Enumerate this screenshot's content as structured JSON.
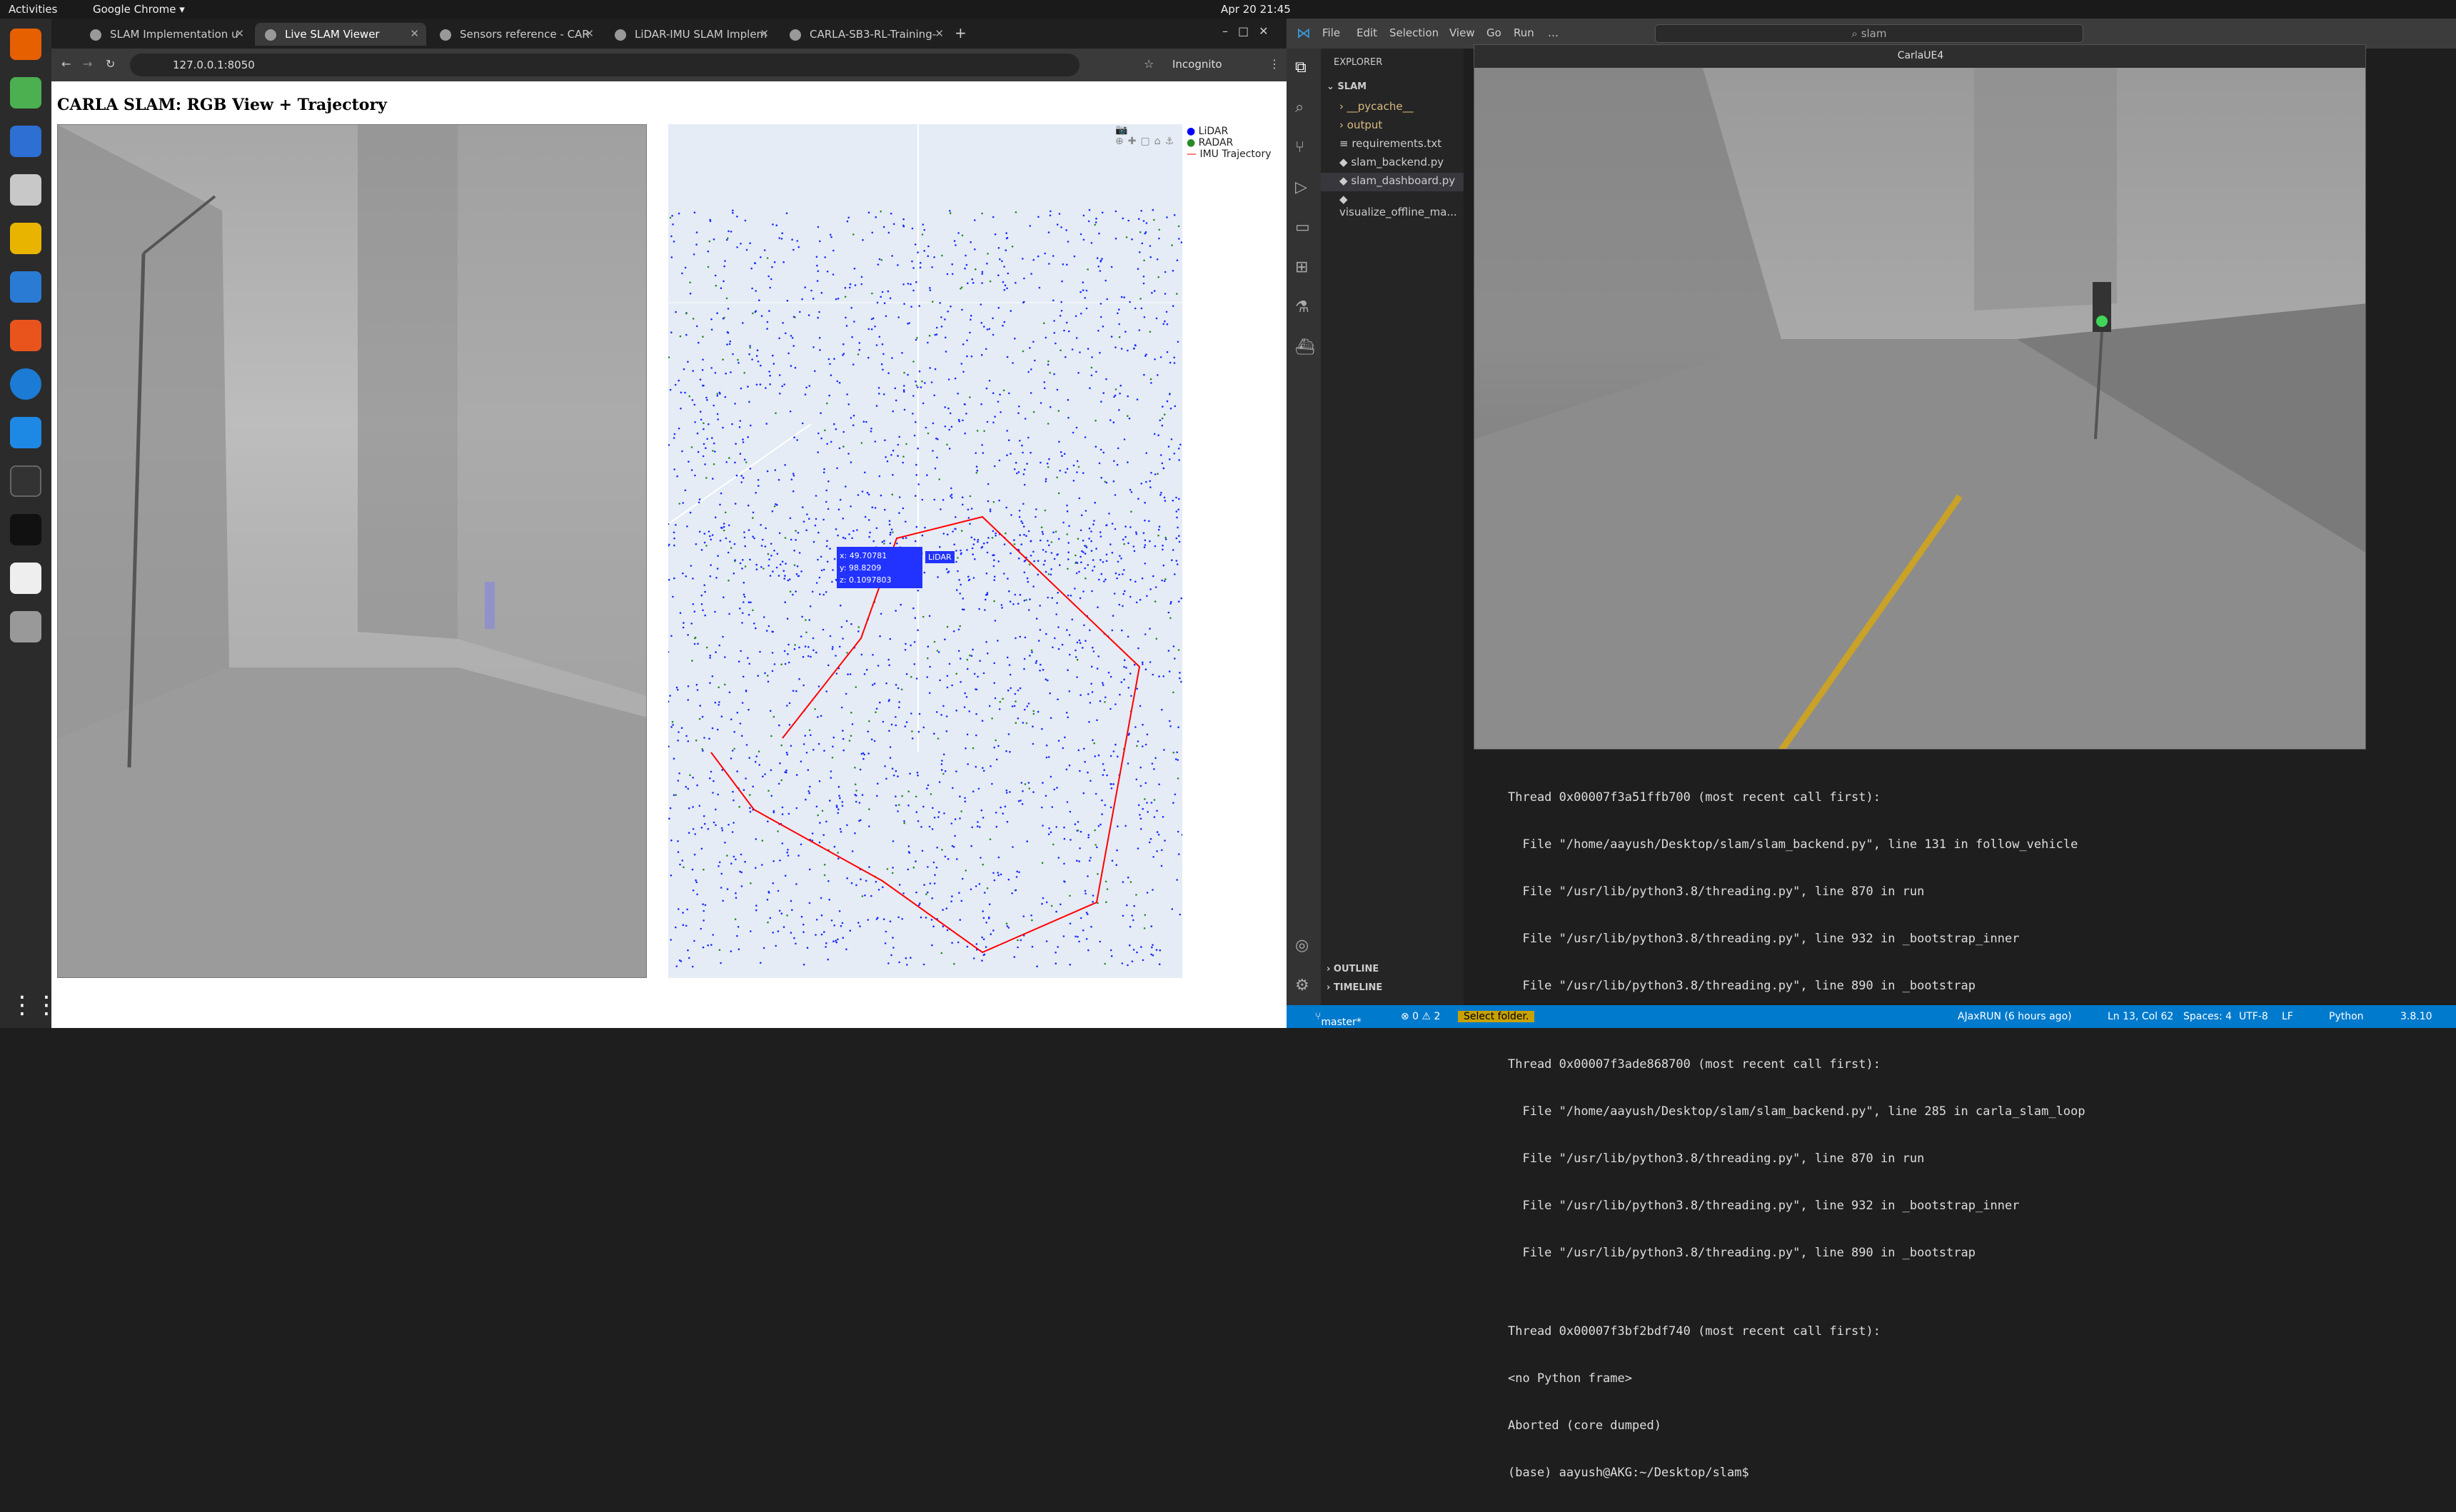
{
  "topbar": {
    "activities": "Activities",
    "app": "Google Chrome ▾",
    "clock": "Apr 20  21:45"
  },
  "dock": {
    "icons": [
      "firefox-icon",
      "chrome-icon",
      "thunderbird-icon",
      "files-icon",
      "rhythmbox-icon",
      "writer-icon",
      "appcenter-icon",
      "help-icon",
      "vscode-icon",
      "terminal-icon",
      "carla-icon",
      "screenshot-icon",
      "search-app-icon",
      "apps-grid-icon"
    ]
  },
  "chrome": {
    "tabs": [
      {
        "label": "SLAM Implementation u",
        "active": false
      },
      {
        "label": "Live SLAM Viewer",
        "active": true
      },
      {
        "label": "Sensors reference - CAR",
        "active": false
      },
      {
        "label": "LiDAR-IMU SLAM Implem",
        "active": false
      },
      {
        "label": "CARLA-SB3-RL-Training-",
        "active": false
      }
    ],
    "url": "127.0.0.1:8050",
    "incognito": "Incognito",
    "page_title": "CARLA SLAM: RGB View + Trajectory"
  },
  "plot": {
    "legend": [
      {
        "label": "LiDAR",
        "color": "#0000ff"
      },
      {
        "label": "RADAR",
        "color": "#2a8a2a"
      },
      {
        "label": "IMU Trajectory",
        "color": "#ff0000"
      }
    ],
    "hover": {
      "x": "x: 49.70781",
      "y": "y: 98.8209",
      "z": "z: 0.1097803",
      "label": "LiDAR"
    }
  },
  "vscode": {
    "menu": [
      "File",
      "Edit",
      "Selection",
      "View",
      "Go",
      "Run",
      "…"
    ],
    "search": "slam",
    "explorer_title": "EXPLORER",
    "folder": "SLAM",
    "files": [
      "__pycache__",
      "output",
      "requirements.txt",
      "slam_backend.py",
      "slam_dashboard.py",
      "visualize_offline_ma..."
    ],
    "outline": "OUTLINE",
    "timeline": "TIMELINE",
    "carla_title": "CarlaUE4",
    "terminal_lines": [
      "Thread 0x00007f3a51ffb700 (most recent call first):",
      "  File \"/home/aayush/Desktop/slam/slam_backend.py\", line 131 in follow_vehicle",
      "  File \"/usr/lib/python3.8/threading.py\", line 870 in run",
      "  File \"/usr/lib/python3.8/threading.py\", line 932 in _bootstrap_inner",
      "  File \"/usr/lib/python3.8/threading.py\", line 890 in _bootstrap",
      "",
      "Thread 0x00007f3ade868700 (most recent call first):",
      "  File \"/home/aayush/Desktop/slam/slam_backend.py\", line 285 in carla_slam_loop",
      "  File \"/usr/lib/python3.8/threading.py\", line 870 in run",
      "  File \"/usr/lib/python3.8/threading.py\", line 932 in _bootstrap_inner",
      "  File \"/usr/lib/python3.8/threading.py\", line 890 in _bootstrap",
      "",
      "Thread 0x00007f3bf2bdf740 (most recent call first):",
      "<no Python frame>",
      "Aborted (core dumped)",
      "(base) aayush@AKG:~/Desktop/slam$ "
    ],
    "status": {
      "branch": "master*",
      "problems": "⊗ 0 ⚠ 2",
      "folder": "Select folder.",
      "run": "AJaxRUN (6 hours ago)",
      "position": "Ln 13, Col 62",
      "spaces": "Spaces: 4",
      "encoding": "UTF-8",
      "eol": "LF",
      "lang": "Python",
      "version": "3.8.10"
    }
  }
}
